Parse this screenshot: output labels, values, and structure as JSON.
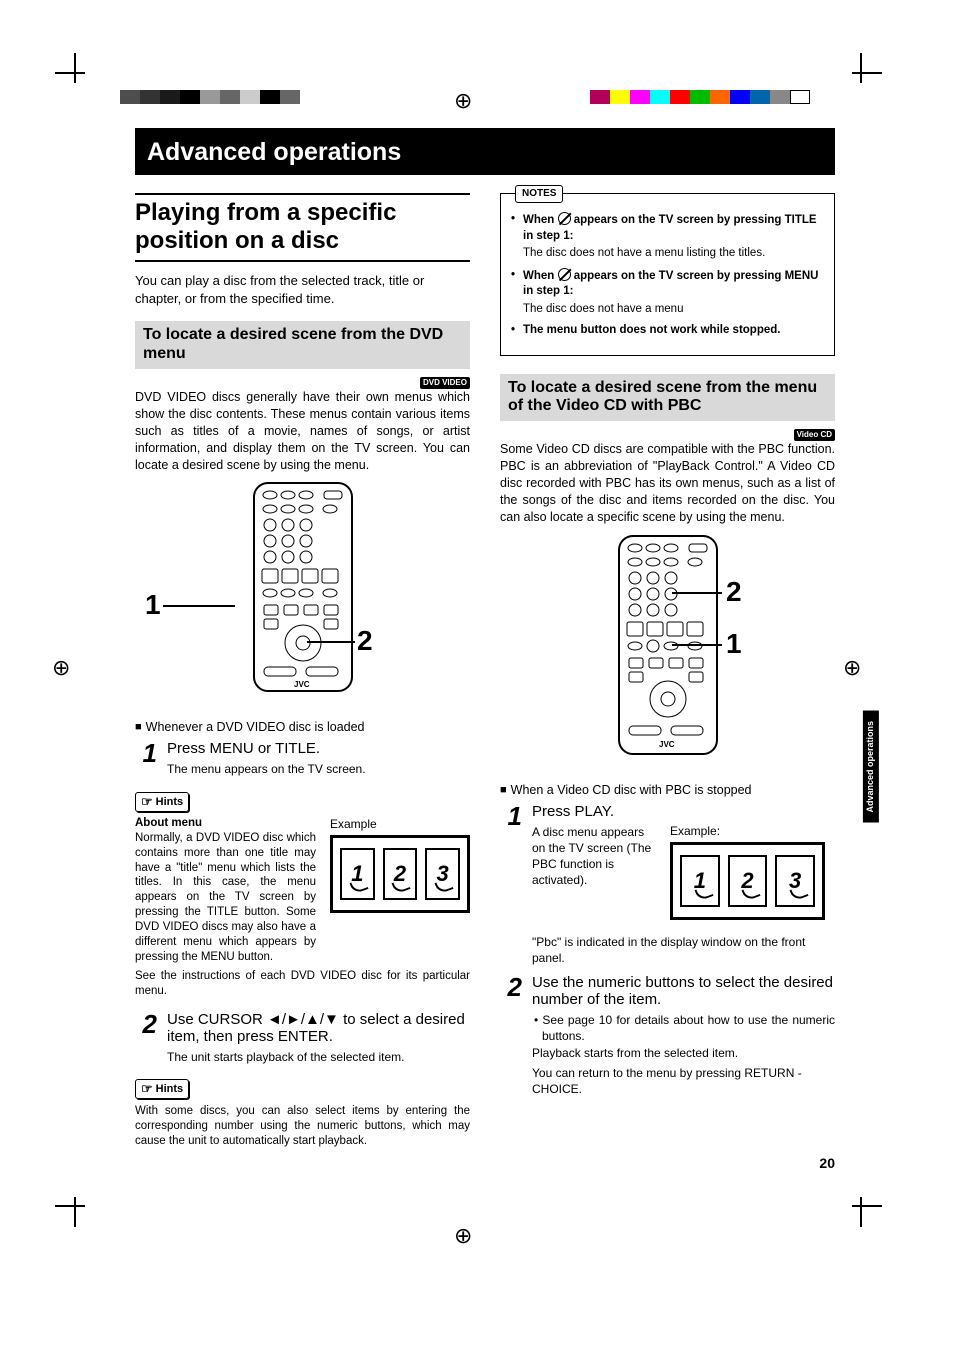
{
  "header": {
    "title": "Advanced operations"
  },
  "section": {
    "heading": "Playing from a specific position on a disc",
    "intro": "You can play a disc from the selected track, title or chapter, or from the specified time."
  },
  "dvd": {
    "sub_heading": "To locate a desired scene from the DVD menu",
    "badge": "DVD VIDEO",
    "body": "DVD VIDEO discs generally have their own menus which show the disc contents. These menus contain various items such as titles of a movie, names of songs, or artist information, and display them on the TV screen. You can locate a desired scene by using the menu.",
    "callout_1": "1",
    "callout_2": "2",
    "when_loaded": "Whenever a DVD VIDEO disc is loaded",
    "step1_num": "1",
    "step1_main": "Press MENU or TITLE.",
    "step1_sub": "The menu appears on the TV screen.",
    "hints_label": "Hints",
    "about_menu_head": "About menu",
    "about_menu_body": "Normally, a DVD VIDEO disc which contains more than one title may have a \"title\" menu which lists the titles. In this case, the menu appears on the TV screen by pressing the TITLE button. Some DVD VIDEO discs may also have a different menu which appears by pressing the MENU button.",
    "example_label": "Example",
    "example_cells": [
      "1",
      "2",
      "3"
    ],
    "see_instructions": "See the instructions of each DVD VIDEO disc for its particular menu.",
    "step2_num": "2",
    "step2_main": "Use CURSOR ◄/►/▲/▼ to select a desired item, then press ENTER.",
    "step2_sub": "The unit starts playback of the selected item.",
    "hint2_body": "With some discs, you can also select items by entering the corresponding number using the numeric buttons, which may cause the unit to automatically start playback."
  },
  "notes": {
    "tag": "NOTES",
    "n1_head_a": "When ",
    "n1_head_b": " appears on the TV screen by pressing TITLE in step 1:",
    "n1_sub": "The disc does not have a menu listing the titles.",
    "n2_head_a": "When ",
    "n2_head_b": " appears on the TV screen by pressing MENU in step 1:",
    "n2_sub": "The disc does not have a menu",
    "n3": "The menu button does not work while stopped."
  },
  "vcd": {
    "sub_heading": "To locate a desired scene from the menu of the Video CD with PBC",
    "badge": "Video CD",
    "body": "Some Video CD discs are compatible with the PBC function.  PBC is an abbreviation of \"PlayBack Control.\" A Video CD disc recorded with PBC has its own menus, such as a list of the songs of the disc and items recorded on the disc. You can also locate a specific scene by using the menu.",
    "callout_1": "1",
    "callout_2": "2",
    "when_stopped": "When a Video CD disc with PBC is stopped",
    "step1_num": "1",
    "step1_main": "Press PLAY.",
    "step1_sub": "A disc menu appears on the TV screen (The PBC function is activated).",
    "example_label": "Example:",
    "example_cells": [
      "1",
      "2",
      "3"
    ],
    "pbc_indicated": "\"Pbc\" is indicated in the display window on the front panel.",
    "step2_num": "2",
    "step2_main": "Use the numeric buttons to select the desired number of the item.",
    "step2_bullet": "See page 10 for details about how to use the numeric buttons.",
    "step2_sub1": "Playback starts from the selected item.",
    "step2_sub2": "You can return to the menu by pressing RETURN - CHOICE."
  },
  "side_tab": "Advanced operations",
  "page_number": "20"
}
